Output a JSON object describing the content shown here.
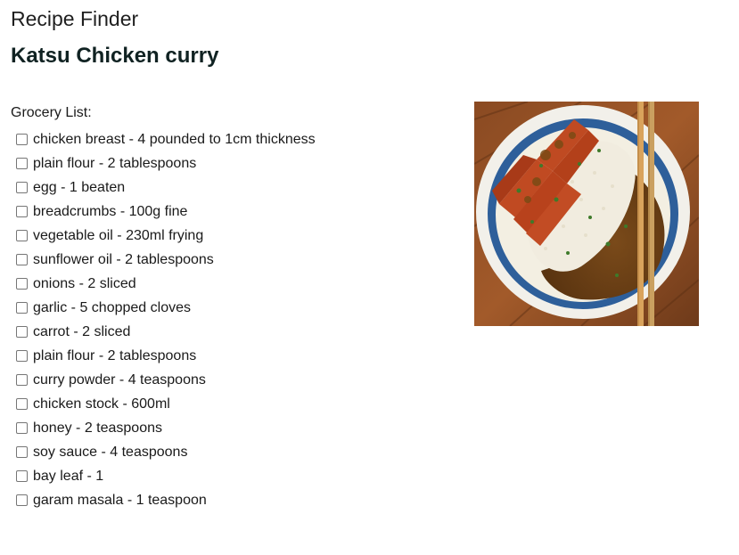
{
  "app": {
    "title": "Recipe Finder"
  },
  "recipe": {
    "title": "Katsu Chicken curry",
    "image_alt": "Katsu chicken curry with rice in a blue bowl with chopsticks"
  },
  "grocery": {
    "heading": "Grocery List:",
    "items": [
      {
        "label": "chicken breast - 4 pounded to 1cm thickness",
        "checked": false
      },
      {
        "label": "plain flour - 2 tablespoons",
        "checked": false
      },
      {
        "label": "egg - 1 beaten",
        "checked": false
      },
      {
        "label": "breadcrumbs - 100g fine",
        "checked": false
      },
      {
        "label": "vegetable oil - 230ml frying",
        "checked": false
      },
      {
        "label": "sunflower oil - 2 tablespoons",
        "checked": false
      },
      {
        "label": "onions - 2 sliced",
        "checked": false
      },
      {
        "label": "garlic - 5 chopped cloves",
        "checked": false
      },
      {
        "label": "carrot - 2 sliced",
        "checked": false
      },
      {
        "label": "plain flour - 2 tablespoons",
        "checked": false
      },
      {
        "label": "curry powder - 4 teaspoons",
        "checked": false
      },
      {
        "label": "chicken stock - 600ml",
        "checked": false
      },
      {
        "label": "honey - 2 teaspoons",
        "checked": false
      },
      {
        "label": "soy sauce - 4 teaspoons",
        "checked": false
      },
      {
        "label": "bay leaf - 1",
        "checked": false
      },
      {
        "label": "garam masala - 1 teaspoon",
        "checked": false
      }
    ]
  }
}
